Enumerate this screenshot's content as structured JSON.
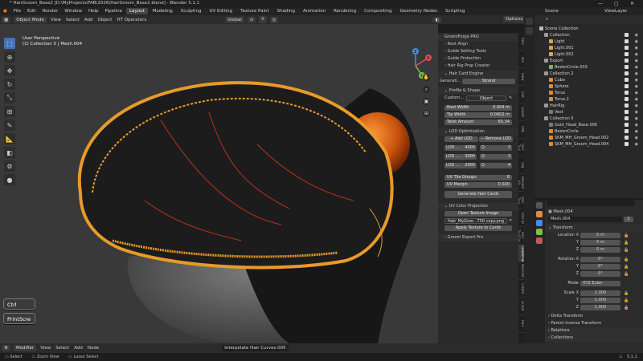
{
  "window": {
    "title": "* HairGroom_Base2 [D:\\MyProjects\\FAB\\2026\\HairGroom_Base2.blend] - Blender 5.1.1",
    "min": "—",
    "max": "▢",
    "close": "✕"
  },
  "menu": [
    "File",
    "Edit",
    "Render",
    "Window",
    "Help",
    "Pipeline"
  ],
  "workspaces": [
    "Layout",
    "Modeling",
    "Sculpting",
    "UV Editing",
    "Texture Paint",
    "Shading",
    "Animation",
    "Rendering",
    "Compositing",
    "Geometry Nodes",
    "Scripting"
  ],
  "workspace_active": "Layout",
  "scene": "Scene",
  "view_layer": "ViewLayer",
  "viewport_header": {
    "mode": "Object Mode",
    "menus": [
      "View",
      "Select",
      "Add",
      "Object",
      "HT Operators"
    ],
    "orientation": "Global",
    "options": "Options"
  },
  "viewport_overlay": {
    "view": "User Perspective",
    "collection": "(1) Collection 5 | Mesh.004"
  },
  "gizmo": {
    "x": "X",
    "y": "Y",
    "z": "Z"
  },
  "npanel": {
    "header": "GroomForge PRO",
    "items": [
      "Root Align",
      "Guide Setting Tools",
      "Guide Protection",
      "Hair Rig Prop Creator",
      "Hair Card Engine"
    ],
    "gen_label": "Generati...",
    "gen_value": "Strand",
    "profile": "Profile & Shape",
    "custom_label": "Custom...",
    "custom_value": "Object",
    "root_width_label": "Root Width",
    "root_width": "0.004 m",
    "tip_width_label": "Tip Width",
    "tip_width": "0.0002 m",
    "twist_label": "Twist Amount",
    "twist": "65.34",
    "lod_header": "LOD Optimization",
    "add_lod": "Add LOD",
    "remove_lod": "Remove LOD",
    "lods": [
      {
        "name": "LOD ...",
        "count": "4000",
        "q": "Q",
        "qv": "3"
      },
      {
        "name": "LOD ...",
        "count": "3000",
        "q": "Q",
        "qv": "3"
      },
      {
        "name": "LOD ...",
        "count": "2000",
        "q": "Q",
        "qv": "4"
      }
    ],
    "uv_groups_label": "UV Tile Groups",
    "uv_groups": "8",
    "uv_margin_label": "UV Margin",
    "uv_margin": "0.020",
    "generate": "Generate Hair Cards",
    "uvcolor_header": "UV Color Projection",
    "open_tex": "Open Texture Image",
    "tex_name": "Hair_MyGroo...T50 copy.png",
    "apply_tex": "Apply Texture to Cards",
    "export": "Groom Export Pro"
  },
  "ntabs": [
    "Item",
    "Tool",
    "View",
    "Edit",
    "Groom",
    "ONE",
    "Hair Tool",
    "OBJ",
    "Blender Kit",
    "Hair Tool",
    "Hair ID",
    "Hair Tool Ext",
    "GroomForge",
    "Animate",
    "Create",
    "Sculpt",
    "Hair"
  ],
  "ntab_active": 12,
  "outliner": {
    "root": "Scene Collection",
    "rows": [
      {
        "name": "Collection",
        "indent": 1,
        "color": "#9a9a9a",
        "sel": false
      },
      {
        "name": "Light",
        "indent": 2,
        "color": "#d4a84a",
        "sel": false
      },
      {
        "name": "Light.001",
        "indent": 2,
        "color": "#d4a84a",
        "sel": false
      },
      {
        "name": "Light.002",
        "indent": 2,
        "color": "#d4a84a",
        "sel": false
      },
      {
        "name": "Export",
        "indent": 1,
        "color": "#9a9a9a",
        "sel": false
      },
      {
        "name": "BezierCircle.003",
        "indent": 2,
        "color": "#7ab06a",
        "sel": false
      },
      {
        "name": "Collection 2",
        "indent": 1,
        "color": "#9a9a9a",
        "sel": false
      },
      {
        "name": "Cube",
        "indent": 2,
        "color": "#e08a3a",
        "sel": false
      },
      {
        "name": "Sphere",
        "indent": 2,
        "color": "#e08a3a",
        "sel": false
      },
      {
        "name": "Torus",
        "indent": 2,
        "color": "#e08a3a",
        "sel": false
      },
      {
        "name": "Torus.2",
        "indent": 2,
        "color": "#e08a3a",
        "sel": false
      },
      {
        "name": "HairRig",
        "indent": 1,
        "color": "#9a9a9a",
        "sel": false
      },
      {
        "name": "Vest",
        "indent": 2,
        "color": "#7a7a7a",
        "sel": false
      },
      {
        "name": "Collection 5",
        "indent": 1,
        "color": "#9a9a9a",
        "sel": false
      },
      {
        "name": "Guid_Head_Base.006",
        "indent": 2,
        "color": "#7a7a7a",
        "sel": false
      },
      {
        "name": "BezierCircle",
        "indent": 2,
        "color": "#e08a3a",
        "sel": false
      },
      {
        "name": "SKM_MH_Groom_Head.002",
        "indent": 2,
        "color": "#e08a3a",
        "sel": false
      },
      {
        "name": "SKM_MH_Groom_Head.004",
        "indent": 2,
        "color": "#e08a3a",
        "sel": false
      }
    ]
  },
  "props": {
    "search_placeholder": "",
    "object_header": "Mesh.004",
    "object_name": "Mesh.004",
    "users": "2",
    "transform": "Transform",
    "loc_label": "Location X",
    "loc": [
      "0 m",
      "0 m",
      "0 m"
    ],
    "rot_label": "Rotation X",
    "rot": [
      "0°",
      "0°",
      "0°"
    ],
    "mode_label": "Mode",
    "mode": "XYZ Euler",
    "scale_label": "Scale X",
    "scale": [
      "1.000",
      "1.000",
      "1.000"
    ],
    "y": "Y",
    "z": "Z",
    "sections": [
      "Delta Transform",
      "Parent Inverse Transform",
      "Relations",
      "Collections"
    ]
  },
  "bottom": {
    "mode": "Modifier",
    "menus": [
      "View",
      "Select",
      "Add",
      "Node"
    ],
    "node": "Interpolate Hair Curves.005"
  },
  "status": {
    "select": "Select",
    "zoom": "Zoom View",
    "lasso": "Lasso Select",
    "version": "5.1.1"
  },
  "keys": {
    "ctrl": "Ctrl",
    "print": "PrintScre"
  }
}
